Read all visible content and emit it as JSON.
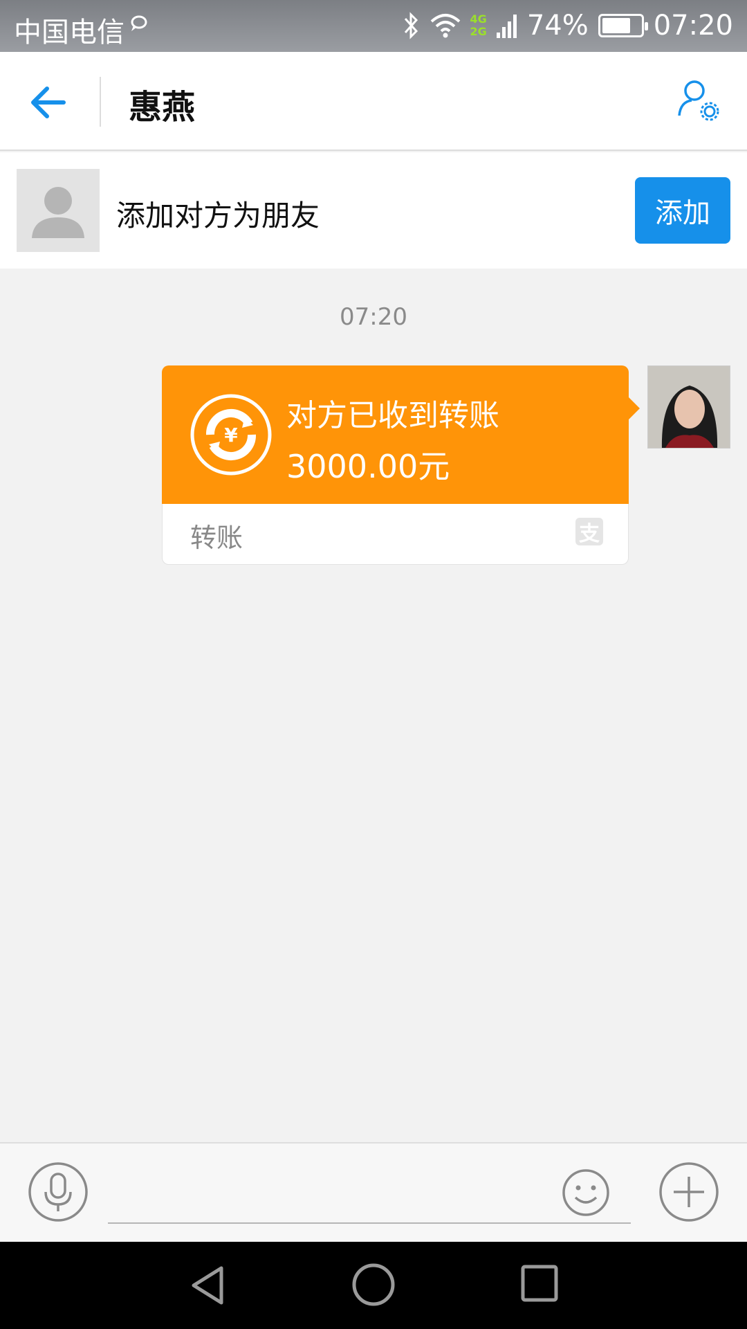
{
  "status_bar": {
    "carrier": "中国电信",
    "network_top": "4G",
    "network_bottom": "2G",
    "battery_percent": "74%",
    "battery_level": 0.74,
    "time": "07:20",
    "icons": [
      "chat-bubble-icon",
      "bluetooth-icon",
      "wifi-icon",
      "signal-icon",
      "battery-icon"
    ]
  },
  "header": {
    "title": "惠燕",
    "back_icon": "arrow-left-icon",
    "settings_icon": "person-settings-icon"
  },
  "add_friend": {
    "text": "添加对方为朋友",
    "button_label": "添加"
  },
  "chat": {
    "timestamp": "07:20",
    "message": {
      "status": "对方已收到转账",
      "amount": "3000.00元",
      "type_label": "转账",
      "brand_glyph": "支"
    }
  },
  "input_bar": {
    "voice_icon": "microphone-icon",
    "emoji_icon": "smiley-icon",
    "plus_icon": "plus-circle-icon"
  },
  "colors": {
    "accent": "#1690ea",
    "transfer_orange": "#ff9408",
    "background": "#f2f2f2"
  }
}
